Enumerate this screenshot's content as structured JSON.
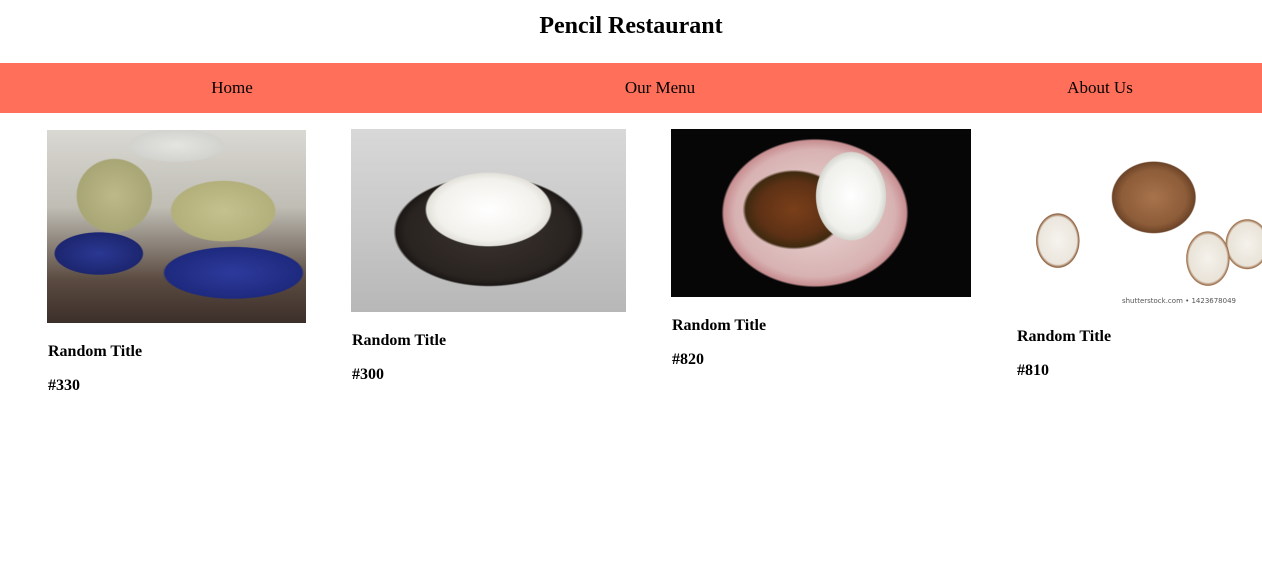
{
  "header": {
    "title": "Pencil Restaurant"
  },
  "nav": {
    "items": [
      {
        "label": "Home"
      },
      {
        "label": "Our Menu"
      },
      {
        "label": "About Us"
      }
    ]
  },
  "colors": {
    "nav_background": "#ff6f59"
  },
  "menu": {
    "items": [
      {
        "title": "Random Title",
        "price": "#330",
        "image": "garri-image"
      },
      {
        "title": "Random Title",
        "price": "#300",
        "image": "white-rice-image"
      },
      {
        "title": "Random Title",
        "price": "#820",
        "image": "soup-and-swallow-image"
      },
      {
        "title": "Random Title",
        "price": "#810",
        "image": "yam-image",
        "watermark": "shutterstock.com • 1423678049"
      }
    ]
  }
}
